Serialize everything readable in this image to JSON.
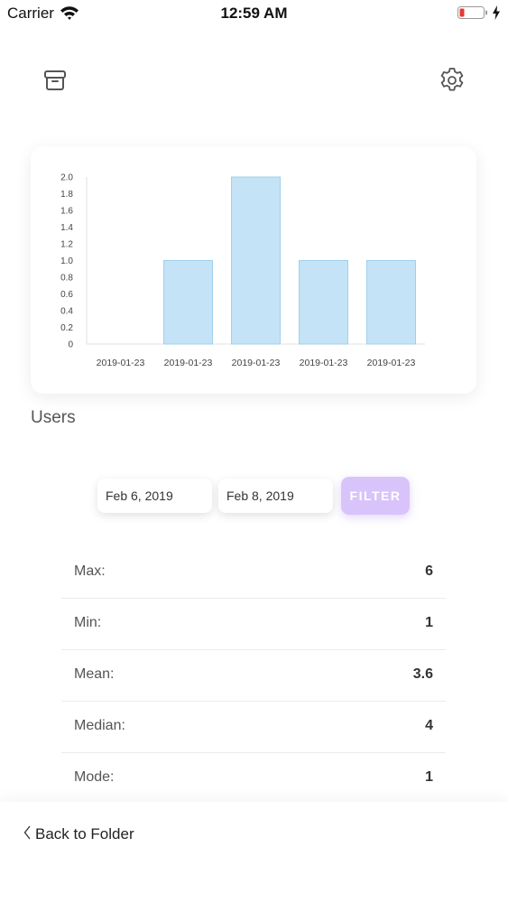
{
  "status_bar": {
    "carrier": "Carrier",
    "time": "12:59 AM",
    "battery_color": "#e53935"
  },
  "nav": {
    "left_icon": "archive-icon",
    "right_icon": "gear-icon"
  },
  "chart_data": {
    "type": "bar",
    "categories": [
      "2019-01-23",
      "2019-01-23",
      "2019-01-23",
      "2019-01-23",
      "2019-01-23"
    ],
    "values": [
      0,
      1,
      2,
      1,
      1
    ],
    "ylim": [
      0,
      2
    ],
    "yticks": [
      "0",
      "0.2",
      "0.4",
      "0.6",
      "0.8",
      "1.0",
      "1.2",
      "1.4",
      "1.6",
      "1.8",
      "2.0"
    ],
    "bar_color": "#c5e3f6",
    "bar_edge_color": "#9fd0ee",
    "grid": false,
    "title": "",
    "xlabel": "",
    "ylabel": ""
  },
  "section": {
    "title": "Users"
  },
  "filter": {
    "from_date": "Feb 6, 2019",
    "to_date": "Feb 8, 2019",
    "button_label": "FILTER",
    "button_color": "#d8c4fb"
  },
  "stats": [
    {
      "label": "Max:",
      "value": "6"
    },
    {
      "label": "Min:",
      "value": "1"
    },
    {
      "label": "Mean:",
      "value": "3.6"
    },
    {
      "label": "Median:",
      "value": "4"
    },
    {
      "label": "Mode:",
      "value": "1"
    }
  ],
  "footer": {
    "back_label": "Back to Folder"
  }
}
